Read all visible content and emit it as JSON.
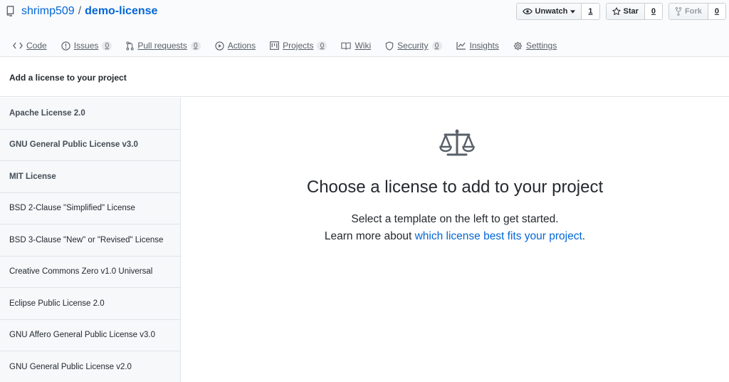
{
  "repo": {
    "owner": "shrimp509",
    "separator": "/",
    "name": "demo-license"
  },
  "actions": {
    "watch": {
      "label": "Unwatch",
      "count": "1"
    },
    "star": {
      "label": "Star",
      "count": "0"
    },
    "fork": {
      "label": "Fork",
      "count": "0"
    }
  },
  "tabs": [
    {
      "label": "Code",
      "icon": "code-icon"
    },
    {
      "label": "Issues",
      "count": "0",
      "icon": "issue-icon"
    },
    {
      "label": "Pull requests",
      "count": "0",
      "icon": "pull-request-icon"
    },
    {
      "label": "Actions",
      "icon": "play-icon"
    },
    {
      "label": "Projects",
      "count": "0",
      "icon": "project-icon"
    },
    {
      "label": "Wiki",
      "icon": "book-icon"
    },
    {
      "label": "Security",
      "count": "0",
      "icon": "shield-icon"
    },
    {
      "label": "Insights",
      "icon": "graph-icon"
    },
    {
      "label": "Settings",
      "icon": "gear-icon"
    }
  ],
  "subhead": {
    "title": "Add a license to your project"
  },
  "licenses": [
    {
      "label": "Apache License 2.0"
    },
    {
      "label": "GNU General Public License v3.0"
    },
    {
      "label": "MIT License"
    },
    {
      "label": "BSD 2-Clause \"Simplified\" License"
    },
    {
      "label": "BSD 3-Clause \"New\" or \"Revised\" License"
    },
    {
      "label": "Creative Commons Zero v1.0 Universal"
    },
    {
      "label": "Eclipse Public License 2.0"
    },
    {
      "label": "GNU Affero General Public License v3.0"
    },
    {
      "label": "GNU General Public License v2.0"
    }
  ],
  "main": {
    "heading": "Choose a license to add to your project",
    "line1": "Select a template on the left to get started.",
    "line2_prefix": "Learn more about ",
    "line2_link": "which license best fits your project",
    "line2_suffix": "."
  },
  "colors": {
    "link": "#0366d6",
    "text": "#24292e",
    "muted": "#586069"
  }
}
